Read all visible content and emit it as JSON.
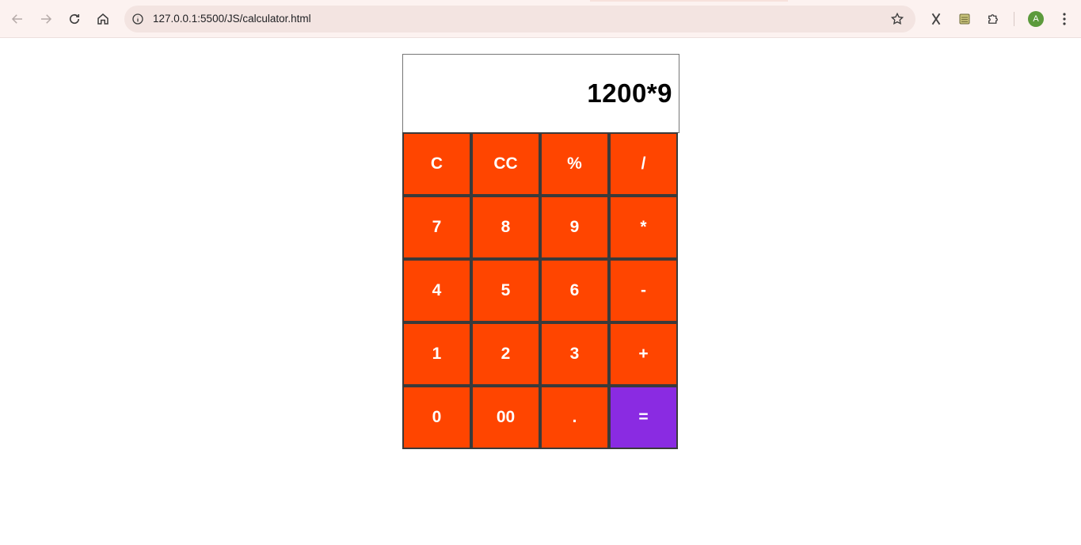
{
  "browser": {
    "url": "127.0.0.1:5500/JS/calculator.html",
    "profile_initial": "A"
  },
  "calculator": {
    "display": "1200*9",
    "keys": [
      "C",
      "CC",
      "%",
      "/",
      "7",
      "8",
      "9",
      "*",
      "4",
      "5",
      "6",
      "-",
      "1",
      "2",
      "3",
      "+",
      "0",
      "00",
      ".",
      "="
    ],
    "colors": {
      "key": "#ff4500",
      "equals": "#8a2be2",
      "key_text": "#ffffff"
    }
  }
}
